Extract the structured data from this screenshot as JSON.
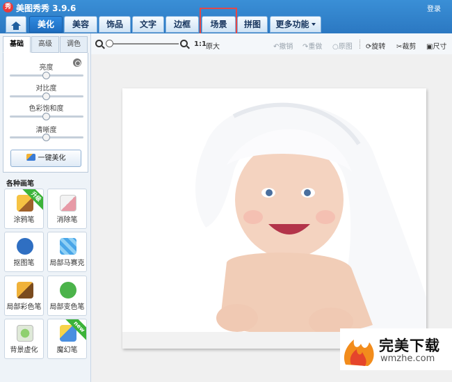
{
  "app": {
    "logo_text": "秀",
    "title": "美图秀秀 3.9.6",
    "login": "登录"
  },
  "tabs": [
    {
      "label": "美化",
      "active": true
    },
    {
      "label": "美容"
    },
    {
      "label": "饰品"
    },
    {
      "label": "文字"
    },
    {
      "label": "边框"
    },
    {
      "label": "场景",
      "highlighted": true
    },
    {
      "label": "拼图"
    },
    {
      "label": "更多功能"
    }
  ],
  "subtabs": [
    "基础",
    "高级",
    "调色"
  ],
  "adjustments": [
    "亮度",
    "对比度",
    "色彩饱和度",
    "清晰度"
  ],
  "one_key": "一键美化",
  "brushes_title": "各种画笔",
  "brushes": [
    {
      "label": "涂鸦笔",
      "badge": "升级"
    },
    {
      "label": "消除笔"
    },
    {
      "label": "抠图笔"
    },
    {
      "label": "局部马赛克"
    },
    {
      "label": "局部彩色笔"
    },
    {
      "label": "局部变色笔"
    },
    {
      "label": "背景虚化"
    },
    {
      "label": "魔幻笔",
      "badge": "new"
    }
  ],
  "toolbar": {
    "ratio": "1:1",
    "original_size": "原大",
    "undo": "撤销",
    "redo": "重做",
    "original": "原图",
    "rotate": "旋转",
    "crop": "裁剪",
    "resize": "尺寸"
  },
  "watermark": {
    "name": "完美下载",
    "url": "wmzhe.com"
  },
  "colors": {
    "title_bar": "#2b78c2",
    "active_tab": "#1e6dc0",
    "highlight": "#e34848",
    "badge_green": "#3cb339"
  }
}
